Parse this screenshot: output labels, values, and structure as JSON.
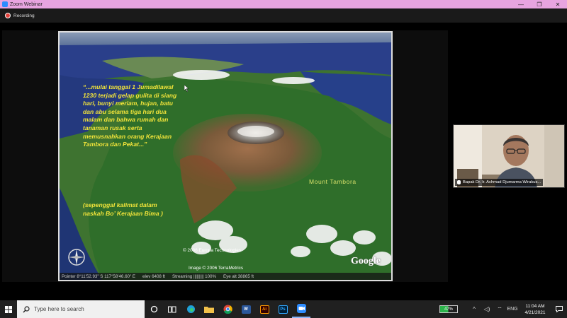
{
  "window": {
    "title": "Zoom Webinar",
    "minimize": "—",
    "maximize": "❐",
    "close": "✕"
  },
  "recording": {
    "label": "Recording"
  },
  "slide": {
    "quote": "“...mulai tanggal 1 Jumadilawal 1230 terjadi gelap gulita di siang hari, bunyi meriam, hujan, batu dan abu selama tiga hari dua malam dan bahwa rumah dan tanaman rusak serta memusnahkan orang Kerajaan Tambora dan Pekat...”",
    "source_prefix": "(sepenggal kalimat dalam naskah ",
    "source_italic": "Bo’",
    "source_suffix": " Kerajaan Bima )",
    "mount_label": "Mount Tambora",
    "copyright_europa": "© 2006 Europa Technologies",
    "copyright_terra": "Image © 2006 TerraMetrics",
    "google_logo": "Google",
    "status": {
      "pointer": "Pointer  8°11'52.93\" S  117°58'46.60\" E",
      "elev": "elev  6408 ft",
      "streaming": "Streaming ||||||||| 100%",
      "eye_alt": "Eye  alt  38865 ft"
    }
  },
  "participant": {
    "name": "Bapak Dr. Ir. Achmad Djumarma Wirakus..."
  },
  "taskbar": {
    "search_placeholder": "Type here to search",
    "battery": "47%",
    "time": "11:04 AM",
    "date": "4/21/2021"
  },
  "colors": {
    "titlebar": "#e8a4e0",
    "quote_text": "#f2e43a",
    "taskbar": "#202020"
  }
}
